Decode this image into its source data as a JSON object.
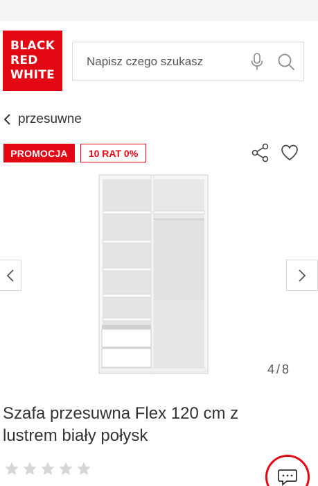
{
  "header": {
    "logo_lines": [
      "BLACK",
      "RED",
      "WHITE"
    ],
    "search_placeholder": "Napisz czego szukasz"
  },
  "breadcrumb": {
    "label": "przesuwne"
  },
  "badges": {
    "promo": "PROMOCJA",
    "installment": "10 RAT 0%"
  },
  "gallery": {
    "current": "4",
    "separator": "/",
    "total": "8"
  },
  "product": {
    "title": "Szafa przesuwna Flex 120 cm z lustrem biały połysk",
    "rating": 0,
    "max_rating": 5
  },
  "colors": {
    "brand_red": "#e30613",
    "text": "#333333",
    "border": "#d9d9d9"
  },
  "icons": [
    "microphone-icon",
    "search-icon",
    "chevron-left-icon",
    "share-icon",
    "heart-icon",
    "chevron-right-icon",
    "star-icon",
    "chat-icon"
  ]
}
